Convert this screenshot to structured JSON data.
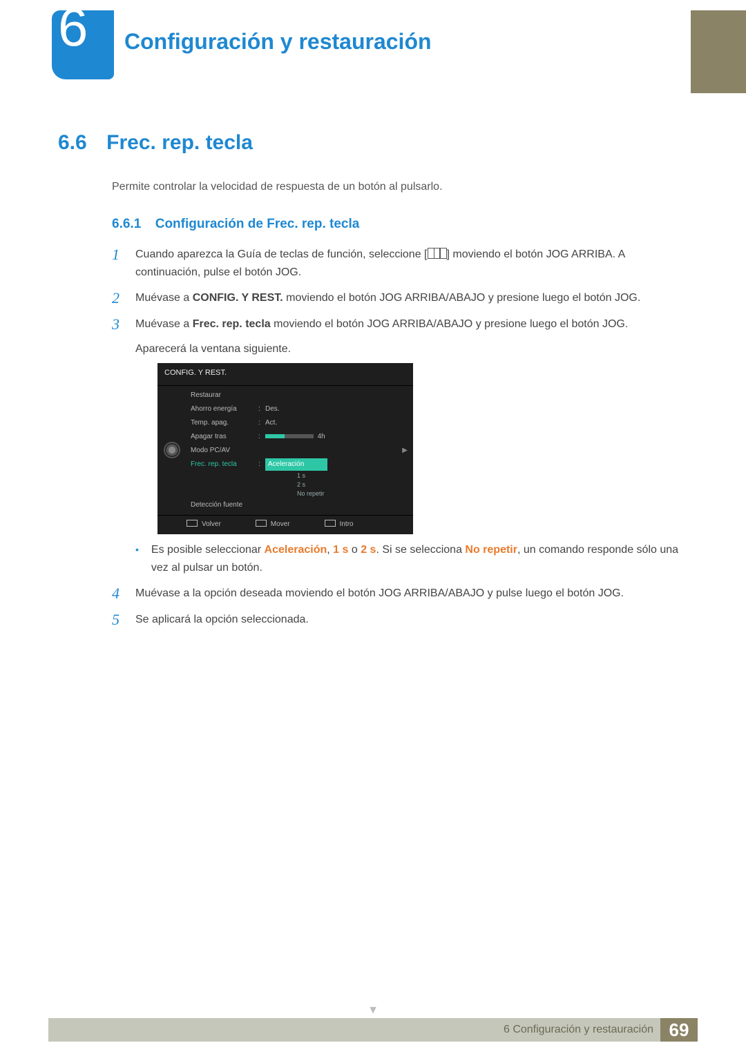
{
  "chapter_num": "6",
  "chapter_title": "Configuración y restauración",
  "section_num": "6.6",
  "section_title": "Frec. rep. tecla",
  "intro": "Permite controlar la velocidad de respuesta de un botón al pulsarlo.",
  "subsection_num": "6.6.1",
  "subsection_title": "Configuración de Frec. rep. tecla",
  "steps": {
    "s1a": "Cuando aparezca la Guía de teclas de función, seleccione [",
    "s1b": "] moviendo el botón JOG ARRIBA. A continuación, pulse el botón JOG.",
    "s2a": "Muévase a ",
    "s2b": "CONFIG. Y REST.",
    "s2c": " moviendo el botón JOG ARRIBA/ABAJO y presione luego el botón JOG.",
    "s3a": "Muévase a ",
    "s3b": "Frec. rep. tecla",
    "s3c": " moviendo el botón JOG ARRIBA/ABAJO y presione luego el botón JOG.",
    "s3d": "Aparecerá la ventana siguiente.",
    "bul_a": "Es posible seleccionar ",
    "bul_acel": "Aceleración",
    "bul_b": ", ",
    "bul_1s": "1 s",
    "bul_c": " o ",
    "bul_2s": "2 s",
    "bul_d": ". Si se selecciona ",
    "bul_nr": "No repetir",
    "bul_e": ", un comando responde sólo una vez al pulsar un botón.",
    "s4": "Muévase a la opción deseada moviendo el botón JOG ARRIBA/ABAJO y pulse luego el botón JOG.",
    "s5": "Se aplicará la opción seleccionada."
  },
  "osd": {
    "title": "CONFIG. Y REST.",
    "rows": [
      {
        "label": "Restaurar",
        "val": ""
      },
      {
        "label": "Ahorro energía",
        "val": "Des."
      },
      {
        "label": "Temp. apag.",
        "val": "Act."
      },
      {
        "label": "Apagar tras",
        "val": "4h",
        "slider": true
      },
      {
        "label": "Modo PC/AV",
        "val": "",
        "arrow": true
      },
      {
        "label": "Frec. rep. tecla",
        "val": "Aceleración",
        "active": true
      },
      {
        "label": "Detección fuente",
        "val": ""
      }
    ],
    "options": [
      "1 s",
      "2 s",
      "No repetir"
    ],
    "footer": {
      "volver": "Volver",
      "mover": "Mover",
      "intro": "Intro"
    }
  },
  "footer": {
    "text": "6 Configuración y restauración",
    "page": "69"
  }
}
